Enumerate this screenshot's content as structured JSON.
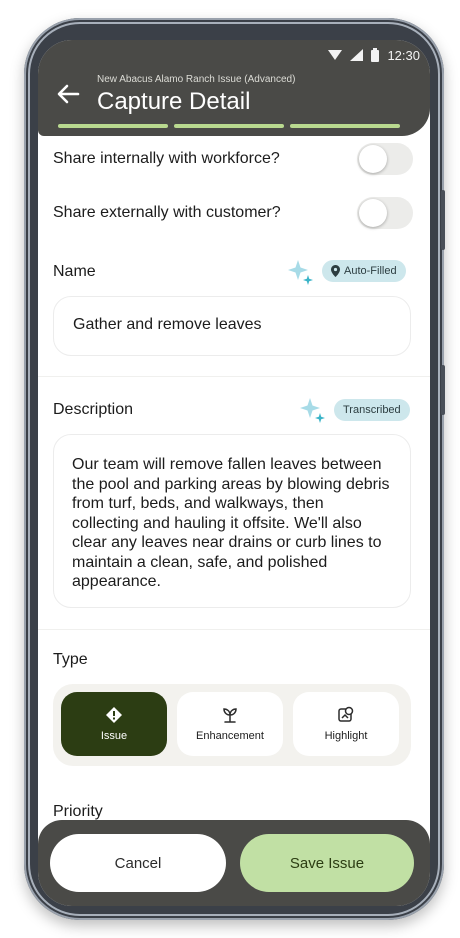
{
  "status_bar": {
    "time": "12:30"
  },
  "header": {
    "subtitle": "New Abacus Alamo Ranch Issue (Advanced)",
    "title": "Capture Detail"
  },
  "toggles": {
    "internal_label": "Share internally with workforce?",
    "external_label": "Share externally with customer?"
  },
  "name_field": {
    "label": "Name",
    "badge": "Auto-Filled",
    "value": "Gather and remove leaves"
  },
  "description_field": {
    "label": "Description",
    "badge": "Transcribed",
    "value": "Our team will remove fallen leaves between the pool and parking areas by blowing debris from turf, beds, and walkways, then collecting and hauling it offsite. We'll also clear any leaves near drains or curb lines to maintain a clean, safe, and polished appearance."
  },
  "type_field": {
    "label": "Type",
    "options": [
      {
        "label": "Issue",
        "icon": "alert-diamond-icon",
        "selected": true
      },
      {
        "label": "Enhancement",
        "icon": "plant-icon",
        "selected": false
      },
      {
        "label": "Highlight",
        "icon": "location-badge-icon",
        "selected": false
      }
    ]
  },
  "priority_field": {
    "label": "Priority"
  },
  "footer": {
    "cancel_label": "Cancel",
    "save_label": "Save Issue"
  },
  "colors": {
    "header_bg": "#4a4a47",
    "accent_green": "#c1e0a4",
    "selected_type": "#2c3d13",
    "badge_bg": "#cde7ec"
  }
}
